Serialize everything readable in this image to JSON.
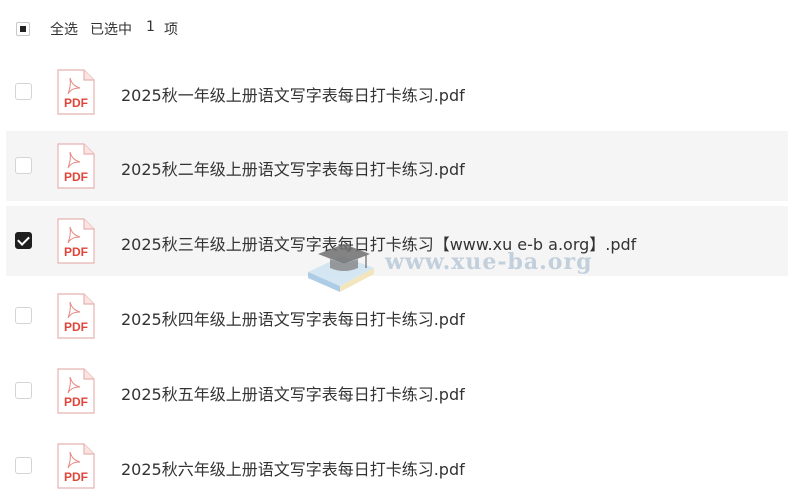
{
  "header": {
    "select_all_label": "全选",
    "selected_label": "已选中",
    "selected_count": "1",
    "selected_unit": "项"
  },
  "files": [
    {
      "name": "2025秋一年级上册语文写字表每日打卡练习.pdf",
      "checked": false,
      "highlighted": false,
      "icon": "pdf-file-icon",
      "icon_text": "PDF"
    },
    {
      "name": "2025秋二年级上册语文写字表每日打卡练习.pdf",
      "checked": false,
      "highlighted": true,
      "icon": "pdf-file-icon",
      "icon_text": "PDF"
    },
    {
      "name": "2025秋三年级上册语文写字表每日打卡练习【www.xu e-b a.org】.pdf",
      "checked": true,
      "highlighted": true,
      "icon": "pdf-file-icon",
      "icon_text": "PDF"
    },
    {
      "name": "2025秋四年级上册语文写字表每日打卡练习.pdf",
      "checked": false,
      "highlighted": false,
      "icon": "pdf-file-icon",
      "icon_text": "PDF"
    },
    {
      "name": "2025秋五年级上册语文写字表每日打卡练习.pdf",
      "checked": false,
      "highlighted": false,
      "icon": "pdf-file-icon",
      "icon_text": "PDF"
    },
    {
      "name": "2025秋六年级上册语文写字表每日打卡练习.pdf",
      "checked": false,
      "highlighted": false,
      "icon": "pdf-file-icon",
      "icon_text": "PDF"
    }
  ],
  "watermark": {
    "text": "www.xue-ba.org",
    "icon": "graduation-cap-icon"
  },
  "colors": {
    "pdf_red": "#e0453a",
    "highlight_bg": "#f5f5f5",
    "checked_bg": "#1f1f1f",
    "text": "#333333"
  }
}
